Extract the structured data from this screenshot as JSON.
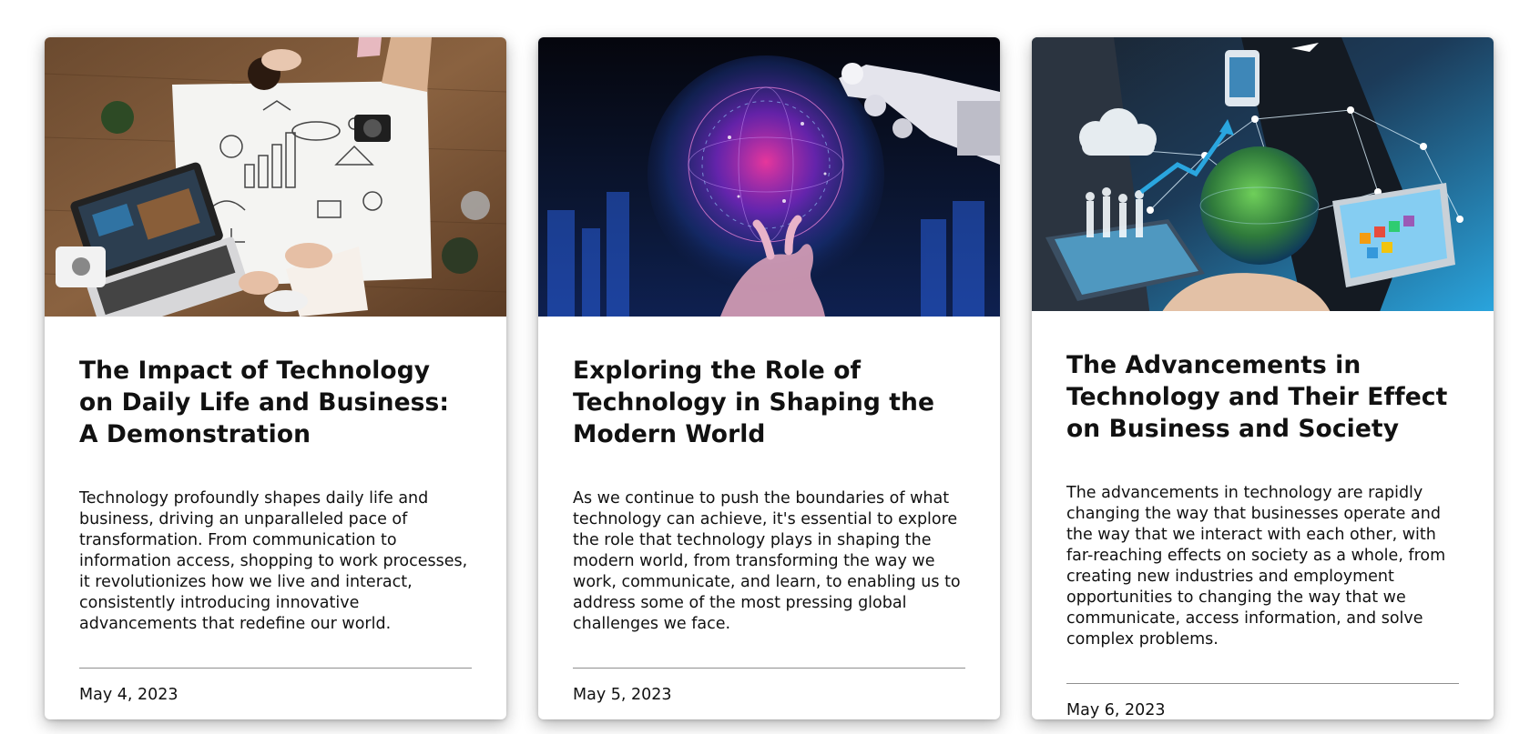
{
  "cards": [
    {
      "image": "workspace-desk-photo",
      "title": "The Impact of Technology on Daily Life and Business: A Demonstration",
      "text": "Technology profoundly shapes daily life and business, driving an unparalleled pace of transformation. From communication to information access, shopping to work processes, it revolutionizes how we live and interact, consistently introducing innovative advancements that redefine our world.",
      "date": "May 4, 2023"
    },
    {
      "image": "robot-hand-hologram-photo",
      "title": "Exploring the Role of Technology in Shaping the Modern World",
      "text": "As we continue to push the boundaries of what technology can achieve, it's essential to explore the role that technology plays in shaping the modern world, from transforming the way we work, communicate, and learn, to enabling us to address some of the most pressing global challenges we face.",
      "date": "May 5, 2023"
    },
    {
      "image": "business-network-globe-photo",
      "title": "The Advancements in Technology and Their Effect on Business and Society",
      "text": "The advancements in technology are rapidly changing the way that businesses operate and the way that we interact with each other, with far-reaching effects on society as a whole, from creating new industries and employment opportunities to changing the way that we communicate, access information, and solve complex problems.",
      "date": "May 6, 2023"
    }
  ]
}
